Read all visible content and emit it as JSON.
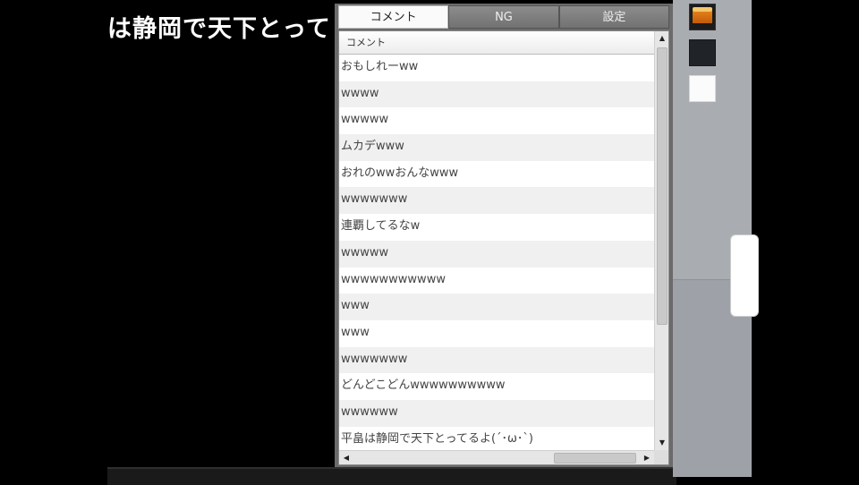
{
  "video": {
    "overlay_text": "は静岡で天下とって"
  },
  "panel": {
    "tabs": [
      {
        "label": "コメント",
        "active": true
      },
      {
        "label": "NG",
        "active": false
      },
      {
        "label": "設定",
        "active": false
      }
    ],
    "list": {
      "column_header": "コメント",
      "comments": [
        "おもしれーww",
        "wwww",
        "wwwww",
        "ムカデwww",
        "おれのwwおんなwww",
        "wwwwwww",
        "連覇してるなw",
        "wwwww",
        "wwwwwwwwwww",
        "www",
        "www",
        "wwwwwww",
        "どんどこどんwwwwwwwwww",
        "wwwwww",
        "平畠は静岡で天下とってるよ(´･ω･`)"
      ]
    },
    "scrollbar_icons": {
      "up": "triangle-up-icon",
      "down": "triangle-down-icon",
      "left": "triangle-left-icon",
      "right": "triangle-right-icon"
    }
  },
  "side_swatches": [
    "cake-icon",
    "#202327",
    "#fbfbfb"
  ]
}
